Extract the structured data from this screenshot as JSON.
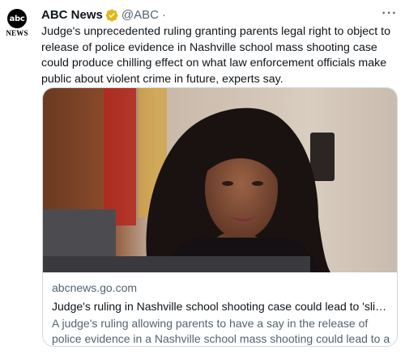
{
  "account": {
    "logo_text": "abc",
    "logo_caption": "NEWS",
    "name": "ABC News",
    "handle": "@ABC",
    "separator": "·"
  },
  "tweet": {
    "text": "Judge's unprecedented ruling granting parents legal right to object to release of police evidence in Nashville school mass shooting case could produce chilling effect on what law enforcement officials make public about violent crime in future, experts say."
  },
  "more_label": "···",
  "card": {
    "image_icon": "photo-of-judge",
    "domain": "abcnews.go.com",
    "title": "Judge's ruling in Nashville school shooting case could lead to 'slipper...",
    "description": "A judge's ruling allowing parents to have a say in the release of police evidence in a Nashville school mass shooting could lead to a \"slipper..."
  },
  "colors": {
    "verified_badge": "#e2b719",
    "secondary_text": "#536471",
    "card_border": "#cfd9de"
  }
}
